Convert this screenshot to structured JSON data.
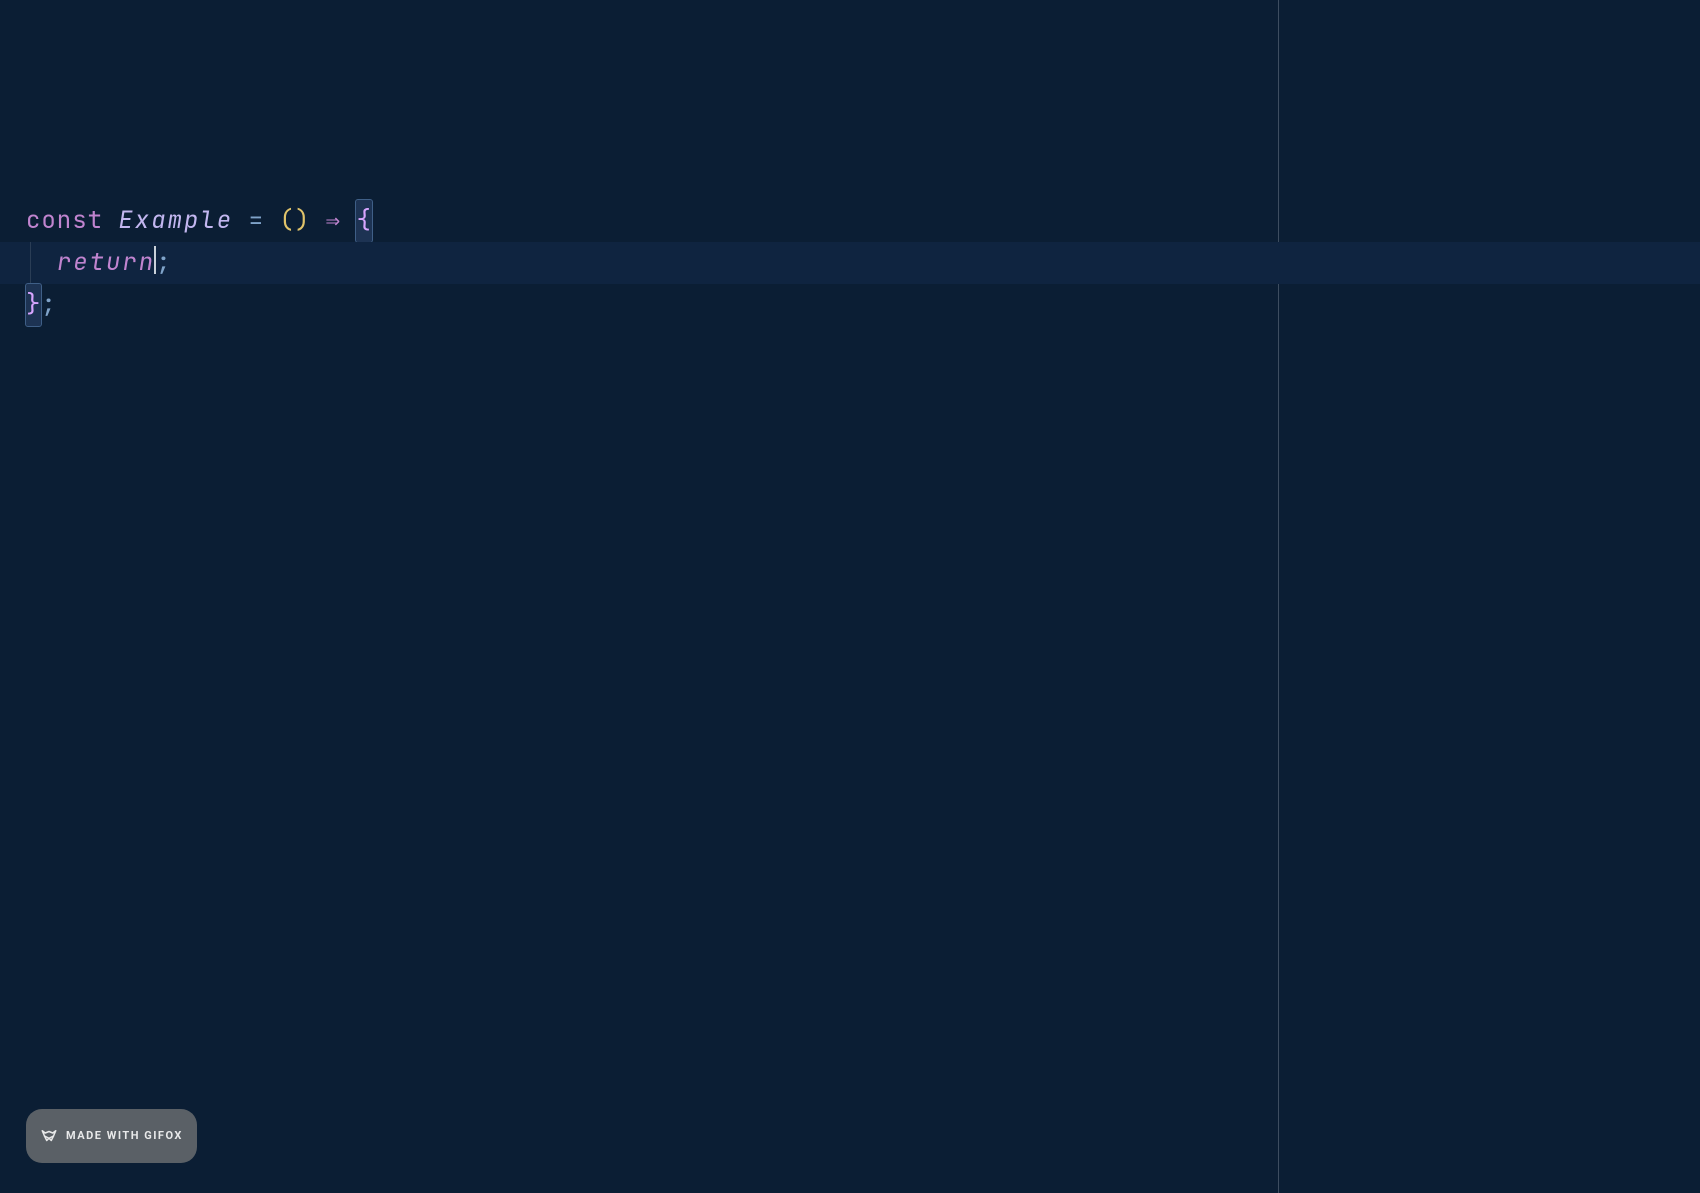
{
  "editor": {
    "ruler_column": 80,
    "line1": {
      "keyword": "const",
      "identifier": "Example",
      "eq": " = ",
      "lparen": "(",
      "rparen": ")",
      "arrow": " ⇒ ",
      "open_brace": "{"
    },
    "line2": {
      "indent": "  ",
      "return_kw": "return",
      "semicolon": ";"
    },
    "line3": {
      "close_brace": "}",
      "semicolon": ";"
    }
  },
  "watermark": {
    "label": "MADE WITH GIFOX"
  }
}
